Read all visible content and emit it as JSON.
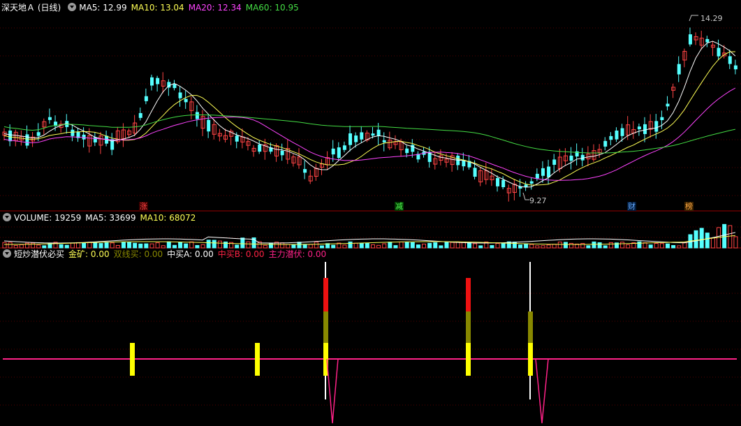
{
  "stock": {
    "title": "深天地Ａ",
    "period": "(日线)"
  },
  "main_indicators": [
    {
      "label": "MA5: 12.99",
      "color": "#ffffff"
    },
    {
      "label": "MA10: 13.04",
      "color": "#ffff55"
    },
    {
      "label": "MA20: 12.34",
      "color": "#ff44ff"
    },
    {
      "label": "MA60: 10.95",
      "color": "#44dd44"
    }
  ],
  "price_high_label": "14.29",
  "price_low_label": "9.27",
  "event_markers": [
    {
      "text": "涨",
      "color": "#ff4444",
      "bg": "#3a0000"
    },
    {
      "text": "减",
      "color": "#55ff55",
      "bg": "#003a00"
    },
    {
      "text": "财",
      "color": "#66aaff",
      "bg": "#001a3a"
    },
    {
      "text": "榜",
      "color": "#ffaa44",
      "bg": "#3a2200"
    }
  ],
  "volume_indicators": [
    {
      "label": "VOLUME: 19259",
      "color": "#ffffff"
    },
    {
      "label": "MA5: 33699",
      "color": "#ffffff"
    },
    {
      "label": "MA10: 68072",
      "color": "#ffff55"
    }
  ],
  "signal_indicators": [
    {
      "label": "短炒潜伏必买",
      "color": "#ffffff"
    },
    {
      "label": "金矿: 0.00",
      "color": "#ffff55"
    },
    {
      "label": "双线买: 0.00",
      "color": "#888800"
    },
    {
      "label": "中买A: 0.00",
      "color": "#ffffff"
    },
    {
      "label": "中买B: 0.00",
      "color": "#ff2244"
    },
    {
      "label": "主力潜伏: 0.00",
      "color": "#ff2288"
    }
  ],
  "colors": {
    "up": "#ff4444",
    "down": "#55ffff",
    "ma5": "#ffffff",
    "ma10": "#ffff55",
    "ma20": "#ff44ff",
    "ma60": "#44dd44",
    "separator": "#990000",
    "signal_base": "#ff2288"
  }
}
